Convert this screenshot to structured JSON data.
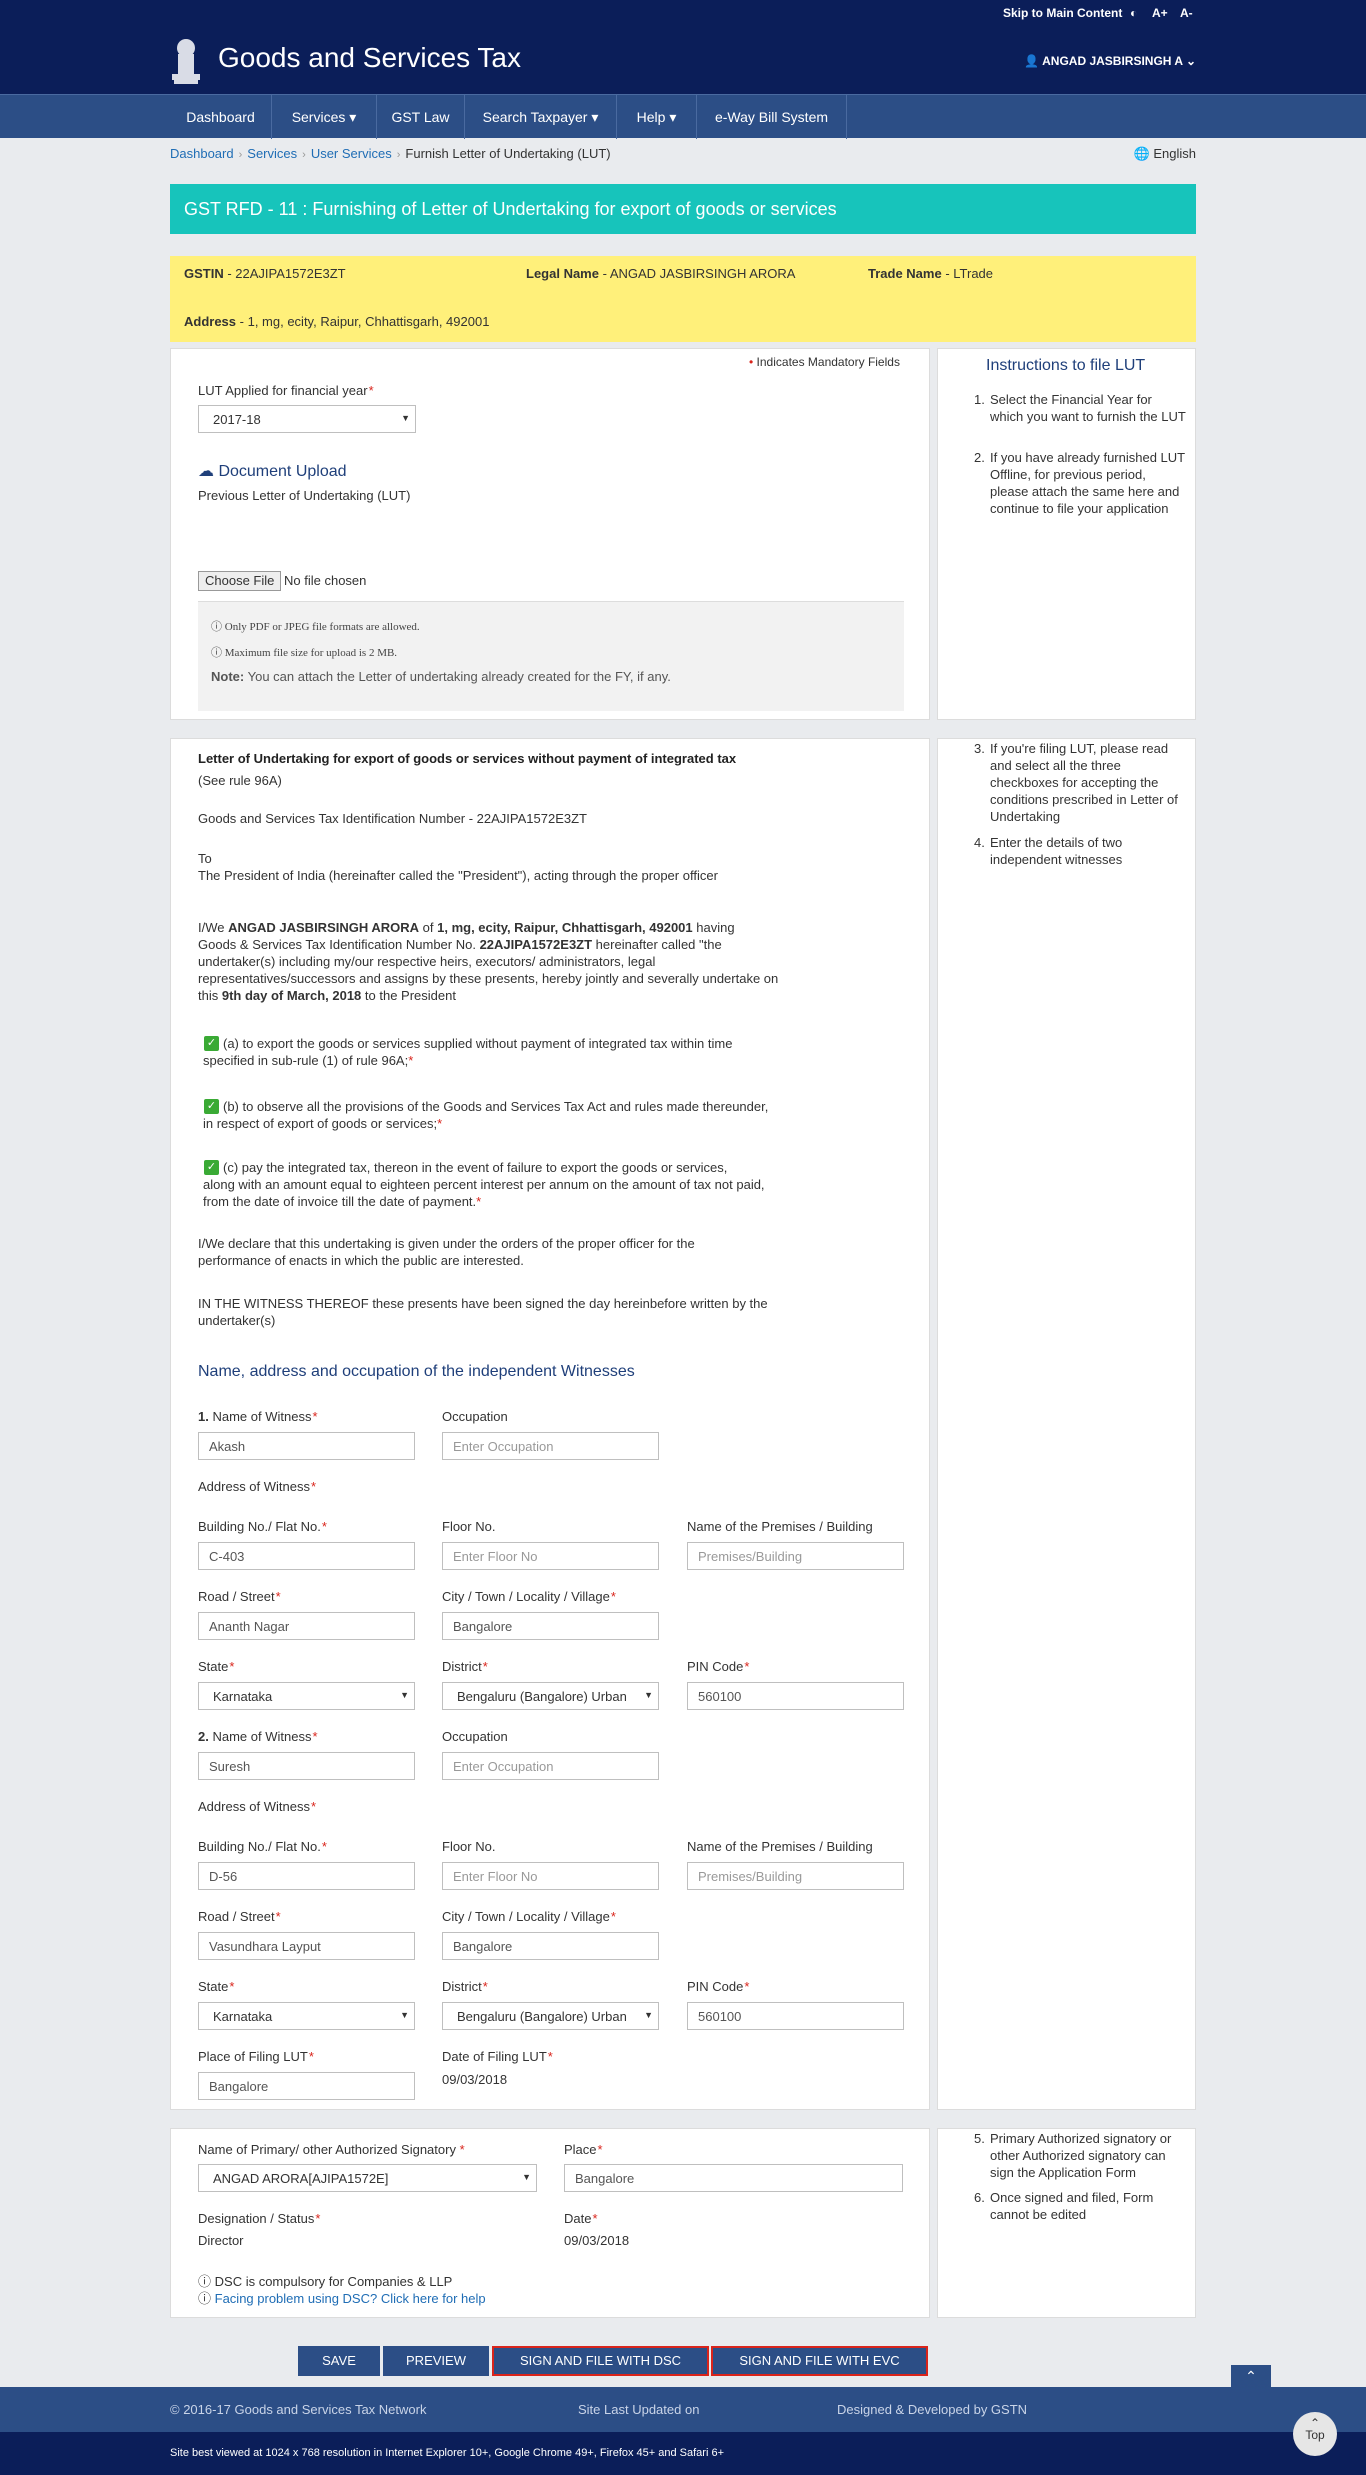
{
  "topbar": {
    "skip": "Skip to Main Content",
    "contrast_icon": "contrast-icon",
    "font_up": "A+",
    "font_down": "A-"
  },
  "header": {
    "title": "Goods and Services Tax",
    "user": "ANGAD JASBIRSINGH A"
  },
  "nav": [
    "Dashboard",
    "Services ▾",
    "GST Law",
    "Search Taxpayer ▾",
    "Help ▾",
    "e-Way Bill System"
  ],
  "breadcrumb": {
    "items": [
      "Dashboard",
      "Services",
      "User Services"
    ],
    "current": "Furnish Letter of Undertaking (LUT)",
    "lang": "English"
  },
  "banner": "GST RFD - 11 : Furnishing of Letter of Undertaking for export of goods or services",
  "taxpayer": {
    "gstin_label": "GSTIN",
    "gstin": "22AJIPA1572E3ZT",
    "legal_label": "Legal Name",
    "legal": "ANGAD JASBIRSINGH ARORA",
    "trade_label": "Trade Name",
    "trade": "LTrade",
    "address_label": "Address",
    "address": "1, mg, ecity, Raipur, Chhattisgarh, 492001"
  },
  "upload": {
    "mandatory_note": "Indicates Mandatory Fields",
    "fy_label": "LUT Applied for financial year",
    "fy_value": "2017-18",
    "doc_title": "Document Upload",
    "doc_sub": "Previous Letter of Undertaking (LUT)",
    "choose": "Choose File",
    "no_file": "No file chosen",
    "info1": "Only PDF or JPEG file formats are allowed.",
    "info2": "Maximum file size for upload is 2 MB.",
    "note_label": "Note:",
    "note": "You can attach the Letter of undertaking already created for the FY, if any."
  },
  "instructions": {
    "title": "Instructions to file LUT",
    "items": [
      "Select the Financial Year for which you want to furnish the LUT",
      "If you have already furnished LUT Offline, for previous period, please attach the same here and continue to file your application",
      "If you're filing LUT, please read and select all the three checkboxes for accepting the conditions prescribed in Letter of Undertaking",
      "Enter the details of two independent witnesses",
      "Primary Authorized signatory or other Authorized signatory can sign the Application Form",
      "Once signed and filed, Form cannot be edited"
    ]
  },
  "letter": {
    "heading": "Letter of Undertaking for export of goods or services without payment of integrated tax",
    "rule": "(See rule 96A)",
    "gstin_line": "Goods and Services Tax Identification Number - 22AJIPA1572E3ZT",
    "to": "To",
    "president": "The President of India (hereinafter called the \"President\"), acting through the proper officer",
    "body_l1a": "I/We ",
    "body_name": "ANGAD JASBIRSINGH ARORA",
    "body_l1b": " of ",
    "body_addr": "1, mg, ecity, Raipur, Chhattisgarh, 492001",
    "body_l1c": " having",
    "body_l2a": "Goods & Services Tax Identification Number No. ",
    "body_gstin": "22AJIPA1572E3ZT",
    "body_l2b": " hereinafter called \"the",
    "body_l3": "undertaker(s) including my/our respective heirs, executors/ administrators, legal",
    "body_l4": "representatives/successors and assigns by these presents, hereby jointly and severally undertake on",
    "body_l5a": "this ",
    "body_date": "9th day of March, 2018",
    "body_l5b": " to the President",
    "cond_a1": "(a) to export the goods or services supplied without payment of integrated tax within time",
    "cond_a2": "specified in sub-rule (1) of rule 96A;",
    "cond_b1": "(b) to observe all the provisions of the Goods and Services Tax Act and rules made thereunder,",
    "cond_b2": "in respect of export of goods or services;",
    "cond_c1": "(c) pay the integrated tax, thereon in the event of failure to export the goods or services,",
    "cond_c2": "along with an amount equal to eighteen percent interest per annum on the amount of tax not paid,",
    "cond_c3": "from the date of invoice till the date of payment.",
    "declare1": "I/We declare that this undertaking is given under the orders of the proper officer for the",
    "declare2": "performance of enacts in which the public are interested.",
    "witness1": "IN THE WITNESS THEREOF these presents have been signed the day hereinbefore written by the",
    "witness2": "undertaker(s)"
  },
  "witnesses": {
    "title": "Name, address and occupation of the independent Witnesses",
    "labels": {
      "name": "Name of Witness",
      "occupation": "Occupation",
      "address": "Address of Witness",
      "building": "Building No./ Flat No.",
      "floor": "Floor No.",
      "premises": "Name of the Premises / Building",
      "road": "Road / Street",
      "city": "City / Town / Locality / Village",
      "state": "State",
      "district": "District",
      "pin": "PIN Code",
      "ph_occupation": "Enter Occupation",
      "ph_floor": "Enter Floor No",
      "ph_premises": "Premises/Building"
    },
    "list": [
      {
        "num": "1.",
        "name": "Akash",
        "building": "C-403",
        "road": "Ananth Nagar",
        "city": "Bangalore",
        "state": "Karnataka",
        "district": "Bengaluru (Bangalore) Urban",
        "pin": "560100"
      },
      {
        "num": "2.",
        "name": "Suresh",
        "building": "D-56",
        "road": "Vasundhara Layput",
        "city": "Bangalore",
        "state": "Karnataka",
        "district": "Bengaluru (Bangalore) Urban",
        "pin": "560100"
      }
    ],
    "place_label": "Place of Filing LUT",
    "place": "Bangalore",
    "date_label": "Date of Filing LUT",
    "date": "09/03/2018"
  },
  "signatory": {
    "name_label": "Name of Primary/ other Authorized Signatory",
    "name": "ANGAD ARORA[AJIPA1572E]",
    "place_label": "Place",
    "place": "Bangalore",
    "desig_label": "Designation / Status",
    "desig": "Director",
    "date_label": "Date",
    "date": "09/03/2018",
    "dsc_note": "DSC is compulsory for Companies & LLP",
    "dsc_help": "Facing problem using DSC? Click here for help"
  },
  "buttons": {
    "save": "SAVE",
    "preview": "PREVIEW",
    "dsc": "SIGN AND FILE WITH DSC",
    "evc": "SIGN AND FILE WITH EVC",
    "top": "Top"
  },
  "footer": {
    "copyright": "© 2016-17 Goods and Services Tax Network",
    "updated": "Site Last Updated on",
    "designed": "Designed & Developed by GSTN",
    "browser": "Site best viewed at 1024 x 768 resolution in Internet Explorer 10+, Google Chrome 49+, Firefox 45+ and Safari 6+"
  },
  "colors": {
    "navy": "#0b1e59",
    "nav": "#2c4e86",
    "teal": "#17c4bb",
    "yellow": "#fff07a",
    "required": "#d9241b",
    "check": "#3aaa35"
  }
}
